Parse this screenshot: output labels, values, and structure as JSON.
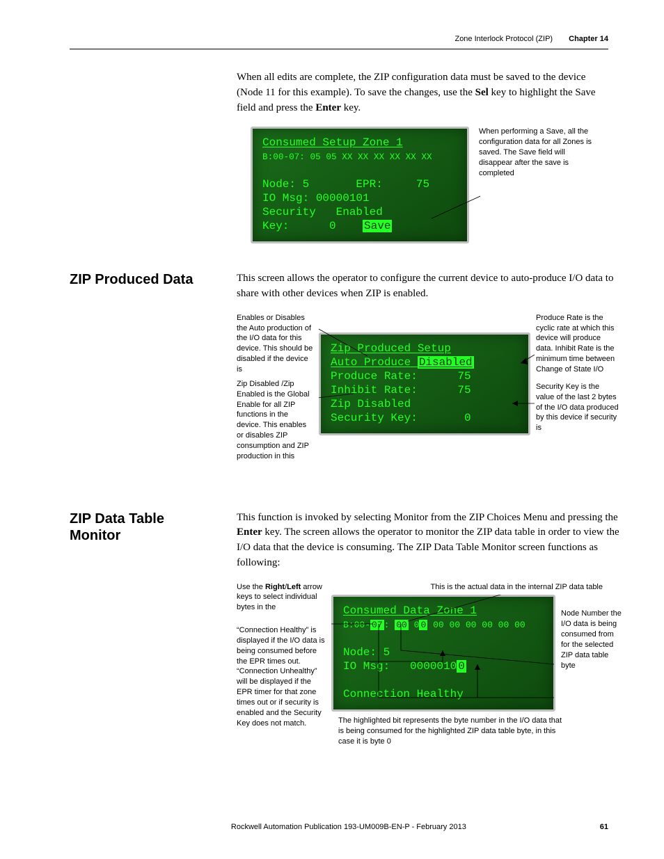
{
  "header": {
    "title": "Zone Interlock Protocol (ZIP)",
    "chapter": "Chapter 14"
  },
  "intro_para": "When all edits are complete, the ZIP configuration data must be saved to the device (Node 11 for this example). To save the changes, use the ",
  "intro_key1": "Sel",
  "intro_mid": " key to highlight the Save field and press the ",
  "intro_key2": "Enter",
  "intro_end": " key.",
  "fig1": {
    "lcd": {
      "l1": "Consumed Setup Zone 1",
      "l2": "B:00-07: 05 05 XX XX XX XX XX XX",
      "l3": "",
      "l4": "Node: 5       EPR:     75",
      "l5": "IO Msg: 00000101",
      "l6": "Security   Enabled",
      "l7_left": "Key:      0    ",
      "l7_save": "Save"
    },
    "callout_right": "When performing a Save, all the configuration data for all Zones is saved. The Save field will disappear after the save is completed"
  },
  "sec2": {
    "heading": "ZIP Produced Data",
    "para": "This screen allows the operator to configure the current device to auto-produce I/O data to share with other devices when ZIP is enabled.",
    "callout_left1": "Enables or Disables the Auto production of the I/O data for this device. This should be disabled if the device is",
    "callout_left2": "Zip Disabled /Zip Enabled is the Global Enable for all ZIP functions in the device. This enables or disables ZIP consumption and ZIP production in this",
    "callout_right1": "Produce Rate is the cyclic rate at which this device will produce data. Inhibit Rate is the minimum time between Change of State I/O",
    "callout_right2": "Security Key is the value of the last 2 bytes of the I/O data produced by this device if security is",
    "lcd": {
      "l1": "Zip Produced Setup",
      "l2_a": "Auto Produce ",
      "l2_b": "Disabled",
      "l3": "Produce Rate:      75",
      "l4": "Inhibit Rate:      75",
      "l5": "Zip Disabled",
      "l6": "Security Key:       0"
    }
  },
  "sec3": {
    "heading": "ZIP Data Table Monitor",
    "para_a": "This function is invoked by selecting Monitor from the ZIP Choices Menu and pressing the ",
    "para_key": "Enter",
    "para_b": " key. The screen allows the operator to monitor the ZIP data table in order to view the I/O data that the device is consuming. The ZIP Data Table Monitor screen functions as following:",
    "callout_left1a": "Use the ",
    "callout_left1b": "Right",
    "callout_left1c": "/",
    "callout_left1d": "Left",
    "callout_left1e": " arrow keys to select individual bytes in the",
    "callout_left2": "“Connection Healthy” is displayed if the I/O data is being consumed before the EPR times out. “Connection Unhealthy” will be displayed if the EPR timer for that zone times out or if security is enabled and the Security Key does not match.",
    "callout_top_right": "This is the actual data in the internal ZIP data table",
    "callout_far_right": "Node Number the I/O data is being consumed from for the selected ZIP data table byte",
    "callout_below": "The highlighted bit represents the byte number in the I/O data that is being consumed for the highlighted ZIP data table byte, in this case it is byte 0",
    "lcd": {
      "l1": "Consumed Data Zone 1",
      "l2_a": "B:00-",
      "l2_hl1": "07",
      "l2_b": ": ",
      "l2_hl2": "00",
      "l2_c": " 0",
      "l2_hl3": "0",
      "l2_d": " 00 00 00 00 00 00",
      "l3": "",
      "l4": "Node: 5",
      "l5_a": "IO Msg:   0000010",
      "l5_hl": "0",
      "l6": "",
      "l7": "Connection Healthy"
    }
  },
  "footer": {
    "pub": "Rockwell Automation Publication 193-UM009B-EN-P - February 2013",
    "page": "61"
  }
}
